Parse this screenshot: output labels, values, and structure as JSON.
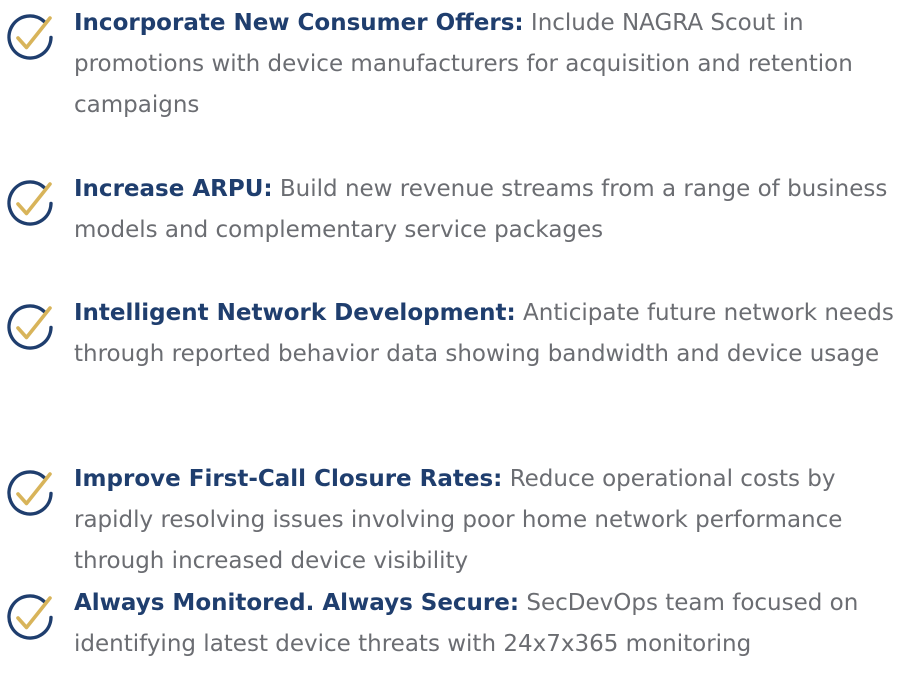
{
  "colors": {
    "title": "#1f3e6e",
    "body": "#6b6d72",
    "check_ring": "#1f3e6e",
    "check_mark": "#d8b45a"
  },
  "icon": "check-circle-icon",
  "benefits": [
    {
      "title": "Incorporate New Consumer Offers:",
      "text": "Include NAGRA Scout in promotions with device manufacturers for acquisition and retention campaigns"
    },
    {
      "title": "Increase ARPU:",
      "text": "Build new revenue streams from a range of business models and complementary service packages"
    },
    {
      "title": "Intelligent Network Development:",
      "text": "Anticipate future network needs through reported behavior data showing bandwidth and device usage"
    },
    {
      "title": "Improve First-Call Closure Rates:",
      "text": "Reduce operational costs by rapidly resolving issues involving poor home network performance through increased device visibility"
    },
    {
      "title": "Always Monitored. Always Secure:",
      "text": "SecDevOps team focused on identifying latest device threats with 24x7x365 monitoring"
    }
  ]
}
